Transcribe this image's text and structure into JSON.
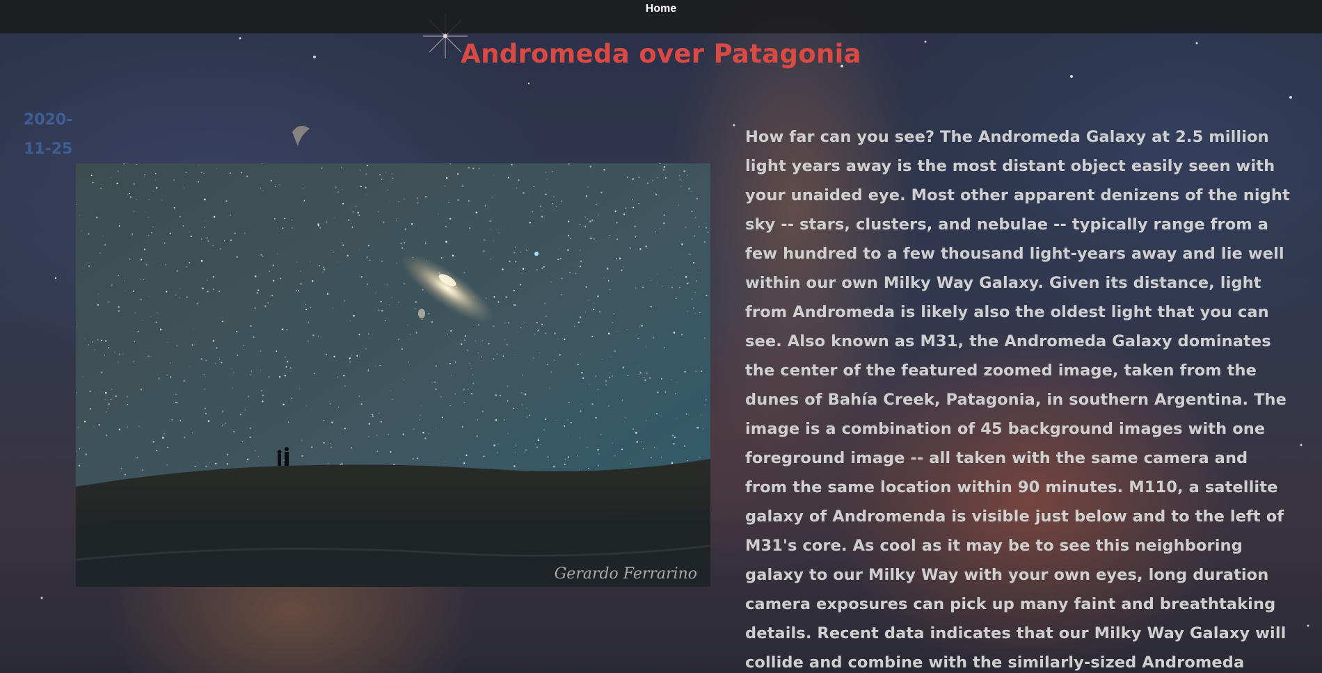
{
  "nav": {
    "home_label": "Home"
  },
  "title": "Andromeda over Patagonia",
  "date": {
    "line1": "2020-",
    "line2": "11-25"
  },
  "image": {
    "alt": "Andromeda over Patagonia",
    "watermark": "Gerardo Ferrarino"
  },
  "explanation": "How far can you see? The Andromeda Galaxy at 2.5 million light years away is the most distant object easily seen with your unaided eye. Most other apparent denizens of the night sky -- stars, clusters, and nebulae -- typically range from a few hundred to a few thousand light-years away and lie well within our own Milky Way Galaxy. Given its distance, light from Andromeda is likely also the oldest light that you can see. Also known as M31, the Andromeda Galaxy dominates the center of the featured zoomed image, taken from the dunes of Bahía Creek, Patagonia, in southern Argentina. The image is a combination of 45 background images with one foreground image -- all taken with the same camera and from the same location within 90 minutes. M110, a satellite galaxy of Andromenda is visible just below and to the left of M31's core. As cool as it may be to see this neighboring galaxy to our Milky Way with your own eyes, long duration camera exposures can pick up many faint and breathtaking details. Recent data indicates that our Milky Way Galaxy will collide and combine with the similarly-sized Andromeda galaxy in a few billion years.",
  "colors": {
    "title": "#d94a45",
    "date": "#3e5f96",
    "text": "#cfcfcf",
    "navbar": "#1c1c1e"
  }
}
